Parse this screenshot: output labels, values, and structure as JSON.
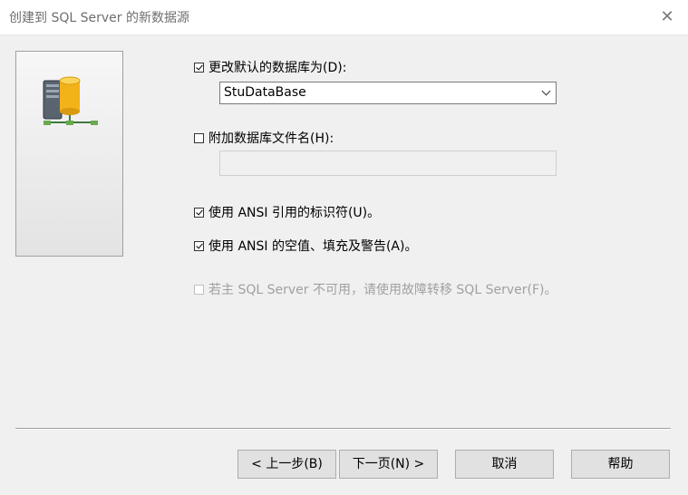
{
  "window": {
    "title": "创建到 SQL Server 的新数据源",
    "close_glyph": "✕"
  },
  "options": {
    "change_default_db": {
      "label": "更改默认的数据库为(D):",
      "checked": true
    },
    "database_select": {
      "value": "StuDataBase"
    },
    "attach_db_file": {
      "label": "附加数据库文件名(H):",
      "checked": false
    },
    "attach_file_path": {
      "value": ""
    },
    "ansi_quoted": {
      "label": "使用 ANSI 引用的标识符(U)。",
      "checked": true
    },
    "ansi_nulls": {
      "label": "使用 ANSI 的空值、填充及警告(A)。",
      "checked": true
    },
    "failover": {
      "label": "若主 SQL Server 不可用，请使用故障转移 SQL Server(F)。",
      "checked": false,
      "disabled": true
    }
  },
  "buttons": {
    "back": "< 上一步(B)",
    "next": "下一页(N) >",
    "cancel": "取消",
    "help": "帮助"
  },
  "icons": {
    "side_panel": "database-server-icon"
  }
}
